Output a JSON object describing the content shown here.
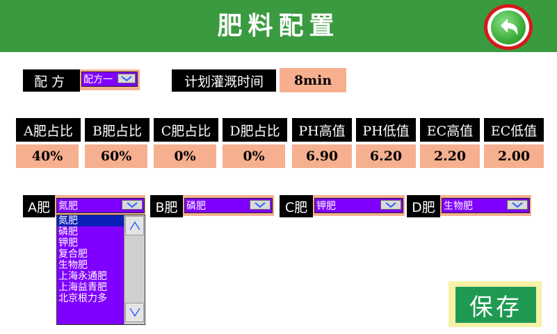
{
  "header": {
    "title": "肥料配置",
    "back_icon": "back-arrow-icon"
  },
  "formula": {
    "label": "配方",
    "value": "配方一"
  },
  "irrigation": {
    "label": "计划灌溉时间",
    "value": "8min"
  },
  "params": [
    {
      "label": "A肥占比",
      "value": "40%"
    },
    {
      "label": "B肥占比",
      "value": "60%"
    },
    {
      "label": "C肥占比",
      "value": "0%"
    },
    {
      "label": "D肥占比",
      "value": "0%"
    },
    {
      "label": "PH高值",
      "value": "6.90"
    },
    {
      "label": "PH低值",
      "value": "6.20"
    },
    {
      "label": "EC高值",
      "value": "2.20"
    },
    {
      "label": "EC低值",
      "value": "2.00"
    }
  ],
  "fertilizers": [
    {
      "label": "A肥",
      "value": "氮肥"
    },
    {
      "label": "B肥",
      "value": "磷肥"
    },
    {
      "label": "C肥",
      "value": "钾肥"
    },
    {
      "label": "D肥",
      "value": "生物肥"
    }
  ],
  "options": [
    "氮肥",
    "磷肥",
    "钾肥",
    "复合肥",
    "生物肥",
    "上海永通肥",
    "上海益青肥",
    "北京根力多"
  ],
  "save": {
    "label": "保存"
  },
  "colors": {
    "header": "#3a9a3f",
    "peach": "#f6b08f",
    "dropdown": "#7f00ff",
    "save": "#1f9a52"
  }
}
